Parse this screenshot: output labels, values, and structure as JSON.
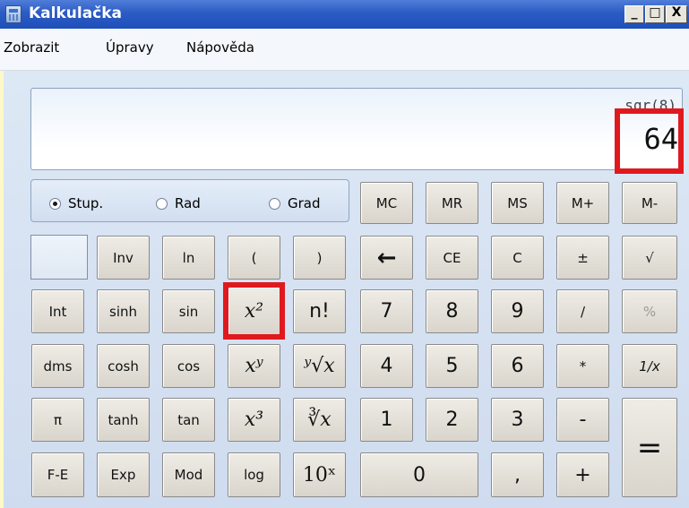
{
  "window": {
    "title": "Kalkulačka",
    "minimize": "_",
    "maximize": "□",
    "close": "X"
  },
  "menu": [
    "Zobrazit",
    "Úpravy",
    "Nápověda"
  ],
  "display": {
    "expression": "sqr(8)",
    "value": "64"
  },
  "angle_units": {
    "options": [
      "Stup.",
      "Rad",
      "Grad"
    ],
    "selected": "Stup."
  },
  "buttons": {
    "memory": [
      "MC",
      "MR",
      "MS",
      "M+",
      "M-"
    ],
    "row1": [
      "Inv",
      "ln",
      "(",
      ")",
      "←",
      "CE",
      "C",
      "±",
      "√"
    ],
    "row2": [
      "Int",
      "sinh",
      "sin",
      "x²",
      "n!",
      "7",
      "8",
      "9",
      "/",
      "%"
    ],
    "row3": [
      "dms",
      "cosh",
      "cos",
      "xʸ",
      "ʸ√x",
      "4",
      "5",
      "6",
      "*",
      "1/x"
    ],
    "row4": [
      "π",
      "tanh",
      "tan",
      "x³",
      "∛x",
      "1",
      "2",
      "3",
      "-",
      "="
    ],
    "row5": [
      "F-E",
      "Exp",
      "Mod",
      "log",
      "10ˣ",
      "0",
      ",",
      "+"
    ]
  },
  "highlight_color": "#e0191f",
  "icons": {
    "app": "calculator-icon"
  }
}
